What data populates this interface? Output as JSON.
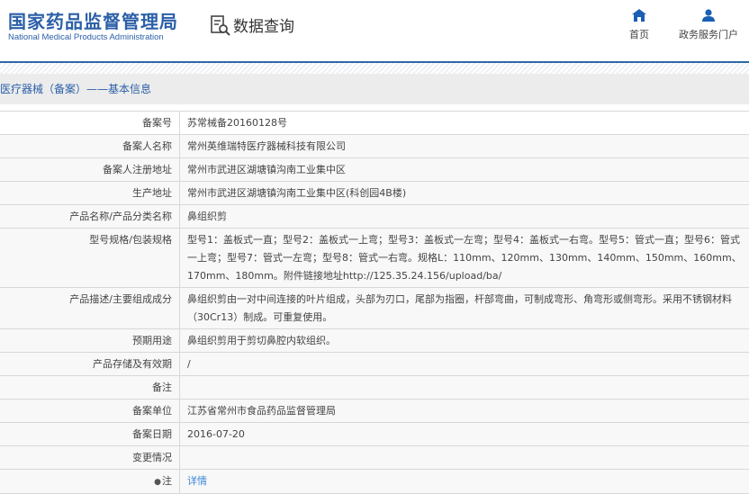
{
  "header": {
    "logo_cn": "国家药品监督管理局",
    "logo_en": "National Medical Products Administration",
    "query_title": "数据查询",
    "nav": [
      {
        "label": "首页",
        "icon": "home-icon"
      },
      {
        "label": "政务服务门户",
        "icon": "user-icon"
      }
    ]
  },
  "title": "医疗器械（备案）——基本信息",
  "rows": [
    {
      "label": "备案号",
      "value": "苏常械备20160128号"
    },
    {
      "label": "备案人名称",
      "value": "常州英维瑞特医疗器械科技有限公司"
    },
    {
      "label": "备案人注册地址",
      "value": "常州市武进区湖塘镇沟南工业集中区"
    },
    {
      "label": "生产地址",
      "value": "常州市武进区湖塘镇沟南工业集中区(科创园4B楼)"
    },
    {
      "label": "产品名称/产品分类名称",
      "value": "鼻组织剪"
    },
    {
      "label": "型号规格/包装规格",
      "value": "型号1：盖板式一直；型号2：盖板式一上弯；型号3：盖板式一左弯；型号4：盖板式一右弯。型号5：管式一直；型号6：管式一上弯；型号7：管式一左弯；型号8：管式一右弯。规格L：110mm、120mm、130mm、140mm、150mm、160mm、170mm、180mm。附件链接地址http://125.35.24.156/upload/ba/"
    },
    {
      "label": "产品描述/主要组成成分",
      "value": "鼻组织剪由一对中间连接的叶片组成，头部为刃口，尾部为指圈，杆部弯曲，可制成弯形、角弯形或侧弯形。采用不锈钢材料（30Cr13）制成。可重复使用。"
    },
    {
      "label": "预期用途",
      "value": "鼻组织剪用于剪切鼻腔内软组织。"
    },
    {
      "label": "产品存储及有效期",
      "value": "/"
    },
    {
      "label": "备注",
      "value": ""
    },
    {
      "label": "备案单位",
      "value": "江苏省常州市食品药品监督管理局"
    },
    {
      "label": "备案日期",
      "value": "2016-07-20"
    },
    {
      "label": "变更情况",
      "value": ""
    },
    {
      "label": "注",
      "value": "详情"
    }
  ]
}
